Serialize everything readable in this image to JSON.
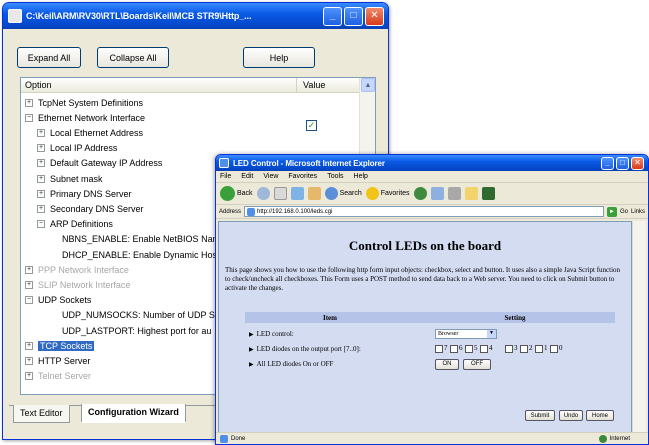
{
  "config_window": {
    "title": "C:\\Keil\\ARM\\RV30\\RTL\\Boards\\Keil\\MCB STR9\\Http_...",
    "expand_all_label": "Expand All",
    "collapse_all_label": "Collapse All",
    "help_label": "Help",
    "col_option": "Option",
    "col_value": "Value",
    "tree": [
      {
        "sign": "+",
        "label": "TcpNet System Definitions",
        "depth": 0,
        "dim": false,
        "selected": false
      },
      {
        "sign": "−",
        "label": "Ethernet Network Interface",
        "depth": 0,
        "dim": false,
        "selected": false
      },
      {
        "sign": "+",
        "label": "Local Ethernet Address",
        "depth": 1,
        "dim": false,
        "selected": false
      },
      {
        "sign": "+",
        "label": "Local IP Address",
        "depth": 1,
        "dim": false,
        "selected": false
      },
      {
        "sign": "+",
        "label": "Default Gateway IP Address",
        "depth": 1,
        "dim": false,
        "selected": false
      },
      {
        "sign": "+",
        "label": "Subnet mask",
        "depth": 1,
        "dim": false,
        "selected": false
      },
      {
        "sign": "+",
        "label": "Primary DNS Server",
        "depth": 1,
        "dim": false,
        "selected": false
      },
      {
        "sign": "+",
        "label": "Secondary DNS Server",
        "depth": 1,
        "dim": false,
        "selected": false
      },
      {
        "sign": "−",
        "label": "ARP Definitions",
        "depth": 1,
        "dim": false,
        "selected": false
      },
      {
        "sign": "",
        "label": "NBNS_ENABLE: Enable NetBIOS Name",
        "depth": 2,
        "dim": false,
        "selected": false
      },
      {
        "sign": "",
        "label": "DHCP_ENABLE: Enable Dynamic Host",
        "depth": 2,
        "dim": false,
        "selected": false
      },
      {
        "sign": "+",
        "label": "PPP Network Interface",
        "depth": 0,
        "dim": true,
        "selected": false
      },
      {
        "sign": "+",
        "label": "SLIP Network Interface",
        "depth": 0,
        "dim": true,
        "selected": false
      },
      {
        "sign": "−",
        "label": "UDP Sockets",
        "depth": 0,
        "dim": false,
        "selected": false
      },
      {
        "sign": "",
        "label": "UDP_NUMSOCKS: Number of UDP So",
        "depth": 2,
        "dim": false,
        "selected": false
      },
      {
        "sign": "",
        "label": "UDP_LASTPORT: Highest port for au",
        "depth": 2,
        "dim": false,
        "selected": false
      },
      {
        "sign": "+",
        "label": "TCP Sockets",
        "depth": 0,
        "dim": false,
        "selected": true
      },
      {
        "sign": "+",
        "label": "HTTP Server",
        "depth": 0,
        "dim": false,
        "selected": false
      },
      {
        "sign": "+",
        "label": "Telnet Server",
        "depth": 0,
        "dim": true,
        "selected": false
      }
    ],
    "tabs": [
      "Text Editor",
      "Configuration Wizard"
    ]
  },
  "ie_window": {
    "title": "LED Control - Microsoft Internet Explorer",
    "menu": [
      "File",
      "Edit",
      "View",
      "Favorites",
      "Tools",
      "Help"
    ],
    "toolbar": {
      "back": "Back",
      "search": "Search",
      "favorites": "Favorites"
    },
    "address_label": "Address",
    "address_value": "http://192.168.0.100/leds.cgi",
    "go_label": "Go",
    "links_label": "Links",
    "page": {
      "heading": "Control LEDs on the board",
      "intro": "This page shows you how to use the following http form input objects: checkbox, select and button. It uses also a simple Java Script function to check/uncheck all checkboxes. This Form uses a POST method to send data back to a Web server. You need to click on Submit button to activate the changes.",
      "col_item": "Item",
      "col_setting": "Setting",
      "row1_label": "LED control:",
      "row1_select": "Browser",
      "row2_label": "LED diodes on the output port [7..0]:",
      "row3_label": "All LED diodes On or OFF",
      "led_labels": [
        "7",
        "6",
        "5",
        "4",
        "3",
        "2",
        "1",
        "0"
      ],
      "on_label": "ON",
      "off_label": "OFF",
      "submit_label": "Submit",
      "undo_label": "Undo",
      "home_label": "Home"
    },
    "status_text": "Done",
    "zone_text": "Internet"
  }
}
